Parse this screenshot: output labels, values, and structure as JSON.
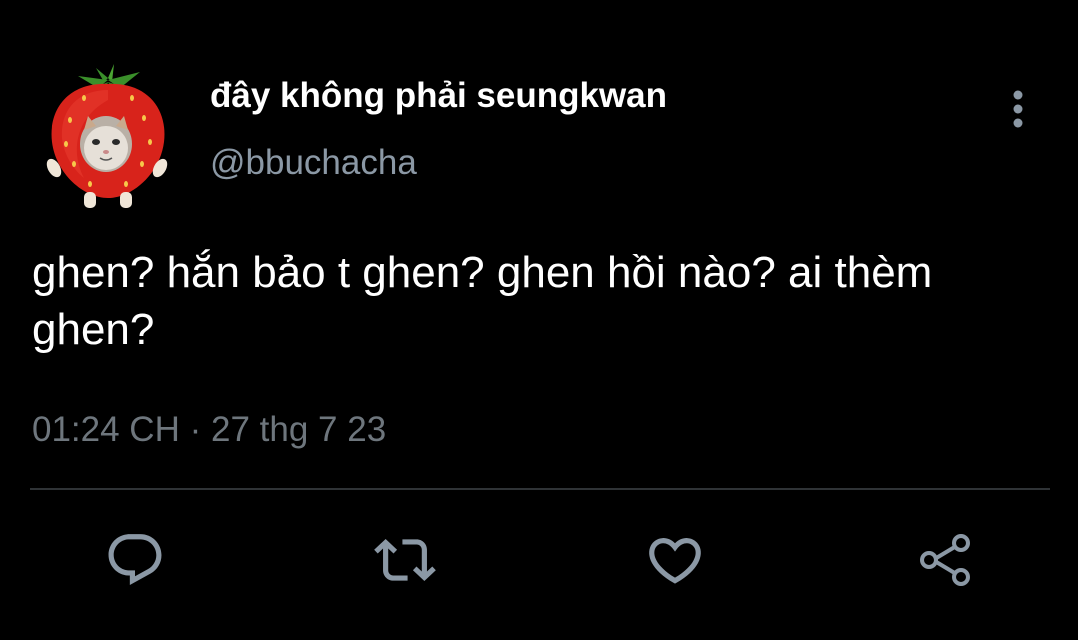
{
  "tweet": {
    "display_name": "đây không phải seungkwan",
    "handle": "@bbuchacha",
    "text": "ghen? hắn bảo t ghen? ghen hồi nào? ai thèm ghen?",
    "time": "01:24 CH",
    "separator": "·",
    "date": "27 thg 7 23"
  },
  "icons": {
    "avatar": "strawberry-cat-avatar",
    "more": "more-vertical-icon",
    "reply": "reply-icon",
    "retweet": "retweet-icon",
    "like": "heart-icon",
    "share": "share-icon"
  },
  "colors": {
    "background": "#000000",
    "primary_text": "#ffffff",
    "secondary_text": "#8b98a5",
    "icon": "#8b98a5",
    "divider": "#2f3336"
  }
}
